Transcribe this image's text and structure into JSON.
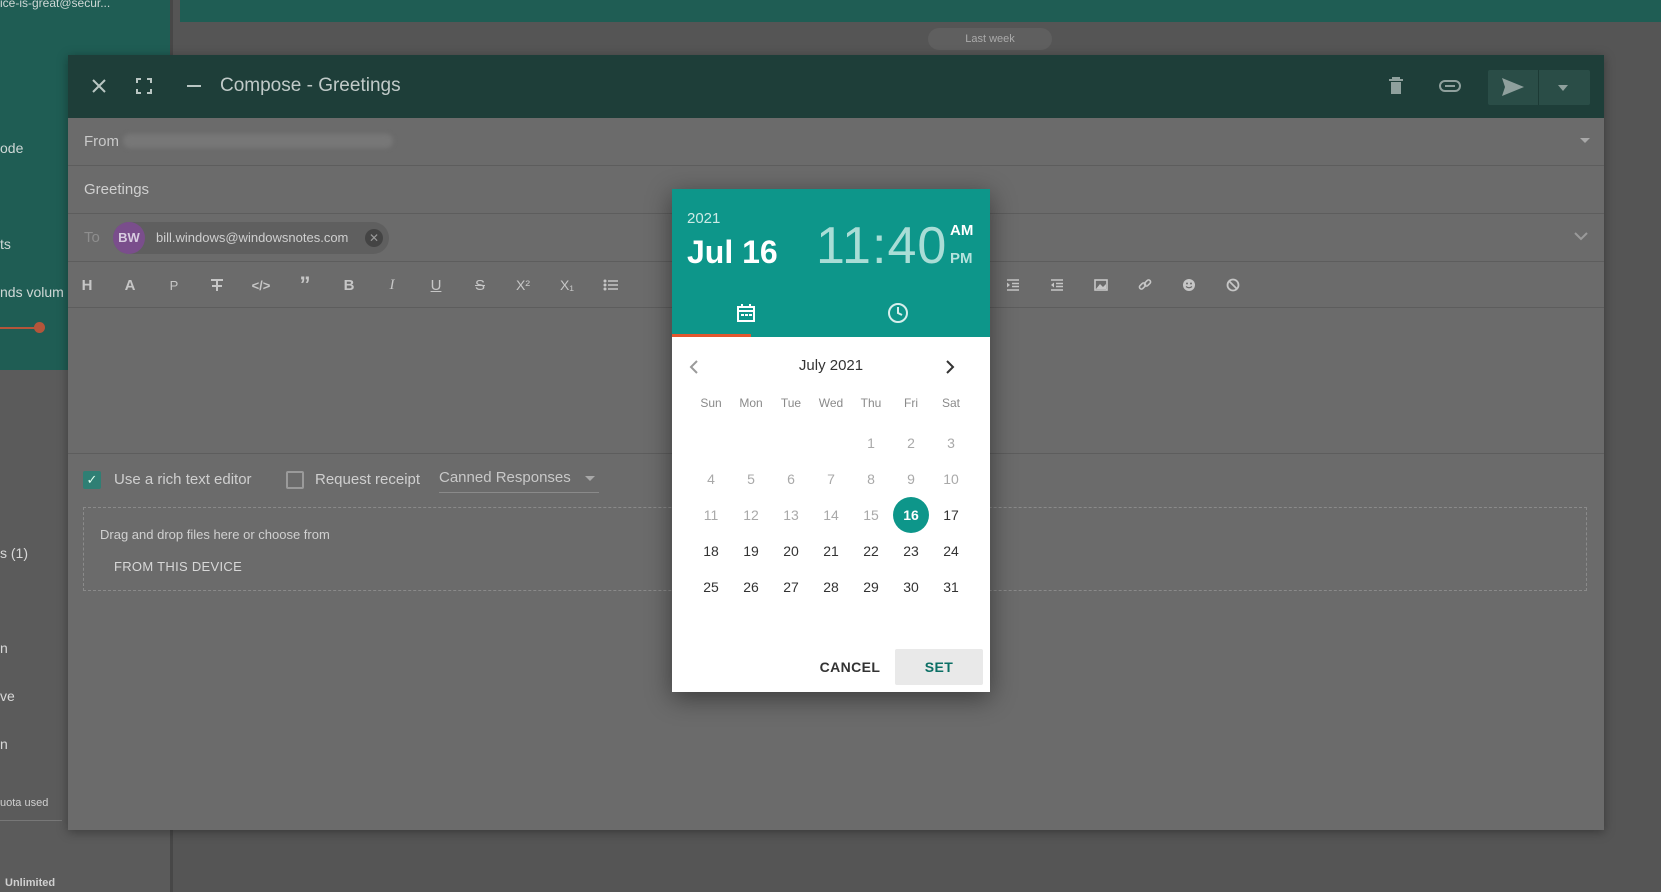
{
  "background": {
    "sidebar_texts": [
      "ice-is-great@secur...",
      "ode",
      "ts",
      "nds volum",
      "s (1)",
      "n",
      "ve",
      "n"
    ],
    "quota_text": "uota used",
    "unlimited_text": "Unlimited",
    "timeline_divider": "Last week"
  },
  "compose": {
    "title": "Compose - Greetings",
    "from_label": "From",
    "subject": "Greetings",
    "to_label": "To",
    "recipient": {
      "initials": "BW",
      "email": "bill.windows@windowsnotes.com"
    },
    "rich_text_label": "Use a rich text editor",
    "request_receipt_label": "Request receipt",
    "canned_responses_label": "Canned Responses",
    "dropzone_text": "Drag and drop files here or choose from",
    "from_device_label": "FROM THIS DEVICE"
  },
  "picker": {
    "year": "2021",
    "date": "Jul 16",
    "hour": "11",
    "minute": "40",
    "am": "AM",
    "pm": "PM",
    "month_label": "July 2021",
    "weekdays": [
      "Sun",
      "Mon",
      "Tue",
      "Wed",
      "Thu",
      "Fri",
      "Sat"
    ],
    "days": {
      "d1": "1",
      "d2": "2",
      "d3": "3",
      "d4": "4",
      "d5": "5",
      "d6": "6",
      "d7": "7",
      "d8": "8",
      "d9": "9",
      "d10": "10",
      "d11": "11",
      "d12": "12",
      "d13": "13",
      "d14": "14",
      "d15": "15",
      "d16": "16",
      "d17": "17",
      "d18": "18",
      "d19": "19",
      "d20": "20",
      "d21": "21",
      "d22": "22",
      "d23": "23",
      "d24": "24",
      "d25": "25",
      "d26": "26",
      "d27": "27",
      "d28": "28",
      "d29": "29",
      "d30": "30",
      "d31": "31"
    },
    "selected_day": "16",
    "cancel_label": "CANCEL",
    "set_label": "SET"
  },
  "colors": {
    "accent": "#0d968a",
    "tab_indicator": "#e2572f",
    "header_dimmed": "#1e3e39"
  }
}
